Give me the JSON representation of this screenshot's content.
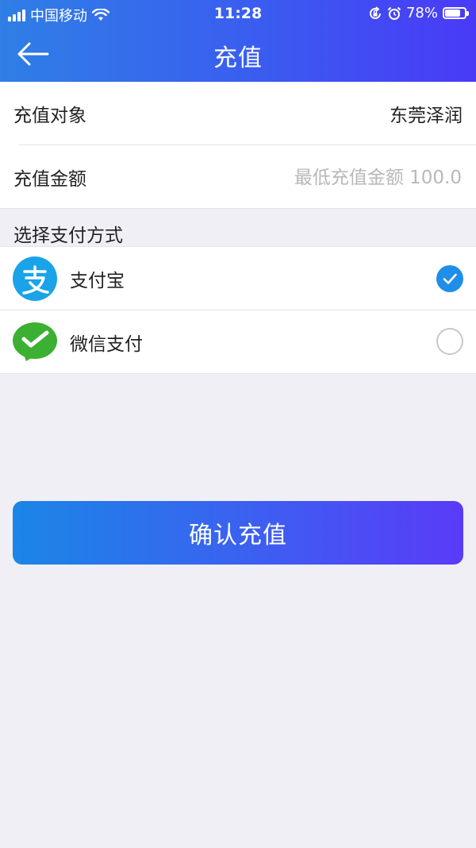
{
  "status_bar": {
    "carrier": "中国移动",
    "time": "11:28",
    "battery_percent": "78%",
    "battery_level": 0.78,
    "icons": [
      "signal-icon",
      "wifi-icon",
      "orientation-lock-icon",
      "alarm-icon",
      "battery-icon"
    ]
  },
  "nav": {
    "title": "充值",
    "back_icon": "back-arrow-icon"
  },
  "form": {
    "target_label": "充值对象",
    "target_value": "东莞泽润",
    "amount_label": "充值金额",
    "amount_value": "",
    "amount_placeholder": "最低充值金额 100.0"
  },
  "payment": {
    "section_label": "选择支付方式",
    "methods": [
      {
        "label": "支付宝",
        "icon": "alipay-icon",
        "color": "#1aa3e8",
        "selected": true
      },
      {
        "label": "微信支付",
        "icon": "wechat-pay-icon",
        "color": "#3bb032",
        "selected": false
      }
    ]
  },
  "confirm_button": {
    "label": "确认充值"
  },
  "colors": {
    "header_gradient_start": "#2f7fe6",
    "header_gradient_end": "#4a3af6",
    "accent": "#1f8ee8",
    "page_background": "#f0eff5"
  }
}
